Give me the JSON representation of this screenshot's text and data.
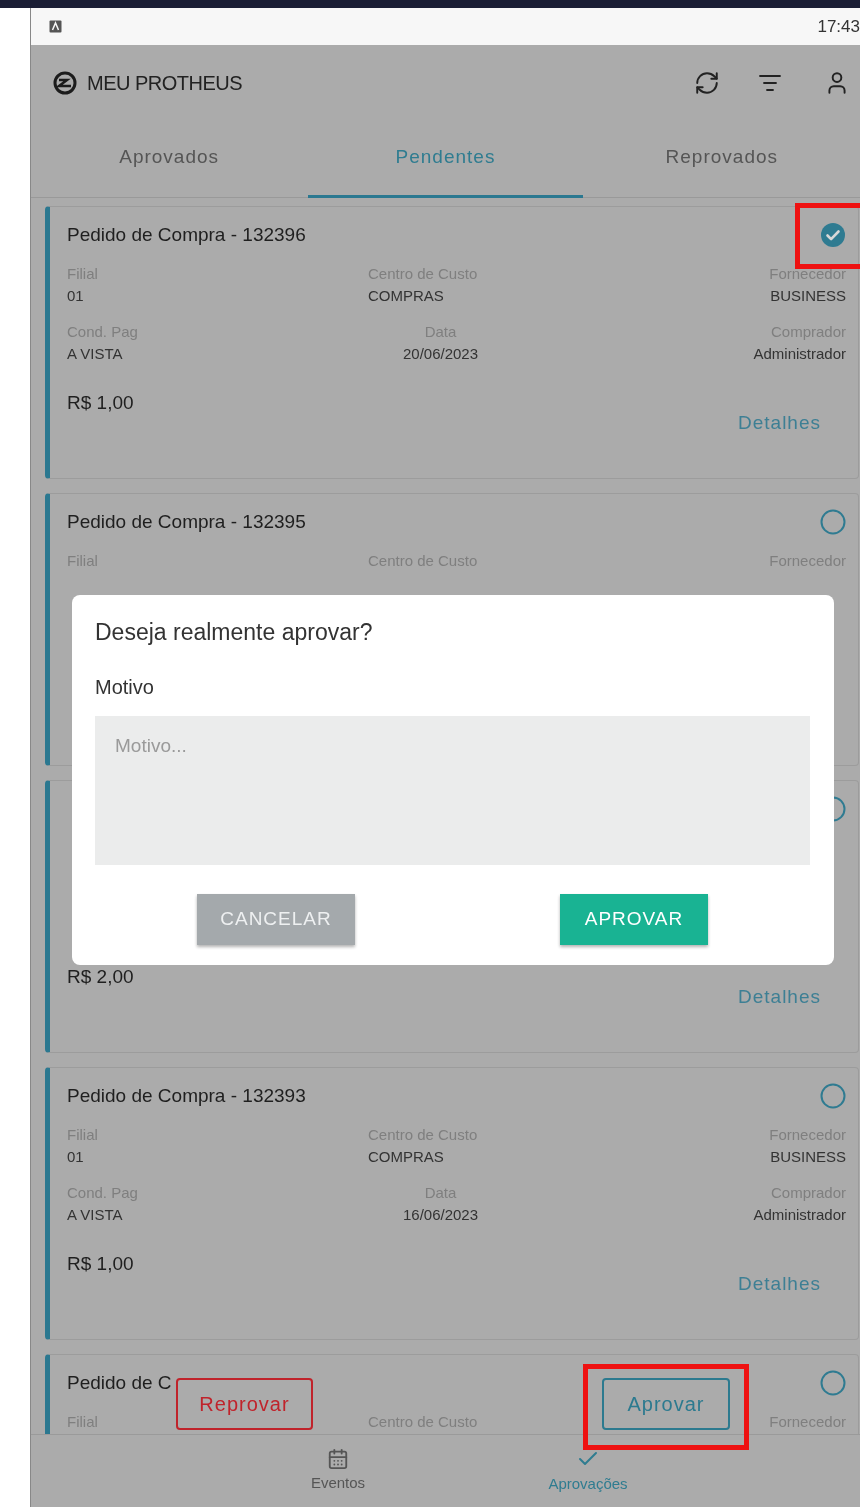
{
  "status_bar": {
    "time": "17:43"
  },
  "app_bar": {
    "title": "MEU PROTHEUS"
  },
  "tabs": [
    {
      "label": "Aprovados",
      "selected": false
    },
    {
      "label": "Pendentes",
      "selected": true
    },
    {
      "label": "Reprovados",
      "selected": false
    }
  ],
  "cards": [
    {
      "title": "Pedido de Compra - 132396",
      "selected": true,
      "highlighted": true,
      "rows": [
        [
          {
            "label": "Filial",
            "value": "01"
          },
          {
            "label": "Centro de Custo",
            "value": "COMPRAS"
          },
          {
            "label": "Fornecedor",
            "value": "BUSINESS"
          }
        ],
        [
          {
            "label": "Cond. Pag",
            "value": "A VISTA"
          },
          {
            "label": "Data",
            "value": "20/06/2023"
          },
          {
            "label": "Comprador",
            "value": "Administrador"
          }
        ]
      ],
      "price": "R$ 1,00",
      "details": "Detalhes"
    },
    {
      "title": "Pedido de Compra - 132395",
      "selected": false,
      "highlighted": false,
      "rows": [
        [
          {
            "label": "Filial"
          },
          {
            "label": "Centro de Custo"
          },
          {
            "label": "Fornecedor"
          }
        ]
      ]
    },
    {
      "selected": false,
      "highlighted": false,
      "price": "R$ 2,00",
      "details": "Detalhes"
    },
    {
      "title": "Pedido de Compra - 132393",
      "selected": false,
      "highlighted": false,
      "rows": [
        [
          {
            "label": "Filial",
            "value": "01"
          },
          {
            "label": "Centro de Custo",
            "value": "COMPRAS"
          },
          {
            "label": "Fornecedor",
            "value": "BUSINESS"
          }
        ],
        [
          {
            "label": "Cond. Pag",
            "value": "A VISTA"
          },
          {
            "label": "Data",
            "value": "16/06/2023"
          },
          {
            "label": "Comprador",
            "value": "Administrador"
          }
        ]
      ],
      "price": "R$ 1,00",
      "details": "Detalhes"
    },
    {
      "title": "Pedido de C",
      "selected": false,
      "highlighted": false,
      "rows": [
        [
          {
            "label": "Filial"
          },
          {
            "label": "Centro de Custo"
          },
          {
            "label": "Fornecedor"
          }
        ]
      ]
    }
  ],
  "dialog": {
    "title": "Deseja realmente aprovar?",
    "field_label": "Motivo",
    "placeholder": "Motivo...",
    "buttons": [
      {
        "label": "CANCELAR",
        "kind": "cancel"
      },
      {
        "label": "APROVAR",
        "kind": "confirm"
      }
    ]
  },
  "floating_actions": [
    {
      "label": "Reprovar",
      "kind": "reject",
      "highlighted": false
    },
    {
      "label": "Aprovar",
      "kind": "approve",
      "highlighted": true
    }
  ],
  "bottom_nav": [
    {
      "label": "Eventos",
      "kind": "calendar",
      "selected": false
    },
    {
      "label": "Aprovações",
      "kind": "check",
      "selected": true
    }
  ]
}
